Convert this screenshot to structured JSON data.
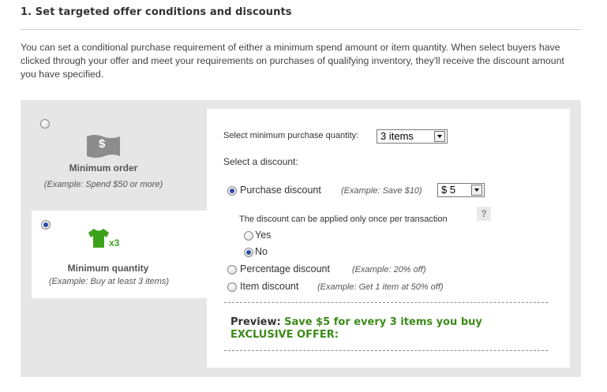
{
  "section": {
    "heading": "1. Set targeted offer conditions and discounts",
    "intro": "You can set a conditional purchase requirement of either a minimum spend amount or item quantity. When select buyers have clicked through your offer and meet your requirements on purchases of qualifying inventory, they'll receive the discount amount you have specified."
  },
  "condition_options": [
    {
      "title": "Minimum order",
      "example": "(Example: Spend $50 or more)",
      "icon": "money-bill-icon",
      "icon_text": "$",
      "selected": false
    },
    {
      "title": "Minimum quantity",
      "example": "(Example: Buy at least 3 items)",
      "icon": "green-tshirt-icon",
      "icon_text": "x3",
      "selected": true
    }
  ],
  "quantity": {
    "label": "Select minimum purchase quantity:",
    "value": "3 items"
  },
  "discount": {
    "label": "Select a discount:",
    "purchase": {
      "label": "Purchase discount",
      "example": "(Example: Save $10)",
      "value": "$ 5",
      "selected": true
    },
    "once_note": "The discount can be applied only once per transaction",
    "help_text": "?",
    "once_yes": "Yes",
    "once_no": "No",
    "once_selected": "No",
    "percentage": {
      "label": "Percentage discount",
      "example": "(Example: 20% off)",
      "selected": false
    },
    "item": {
      "label": "Item discount",
      "example": "(Example: Get 1 item at 50% off)",
      "selected": false
    }
  },
  "preview": {
    "label": "Preview:",
    "text": "Save $5 for every 3 items you buy",
    "offer": "EXCLUSIVE OFFER:"
  },
  "colors": {
    "accent_green": "#3d8b1a",
    "panel_gray": "#e6e6e6",
    "radio_blue": "#2a4fa8"
  }
}
